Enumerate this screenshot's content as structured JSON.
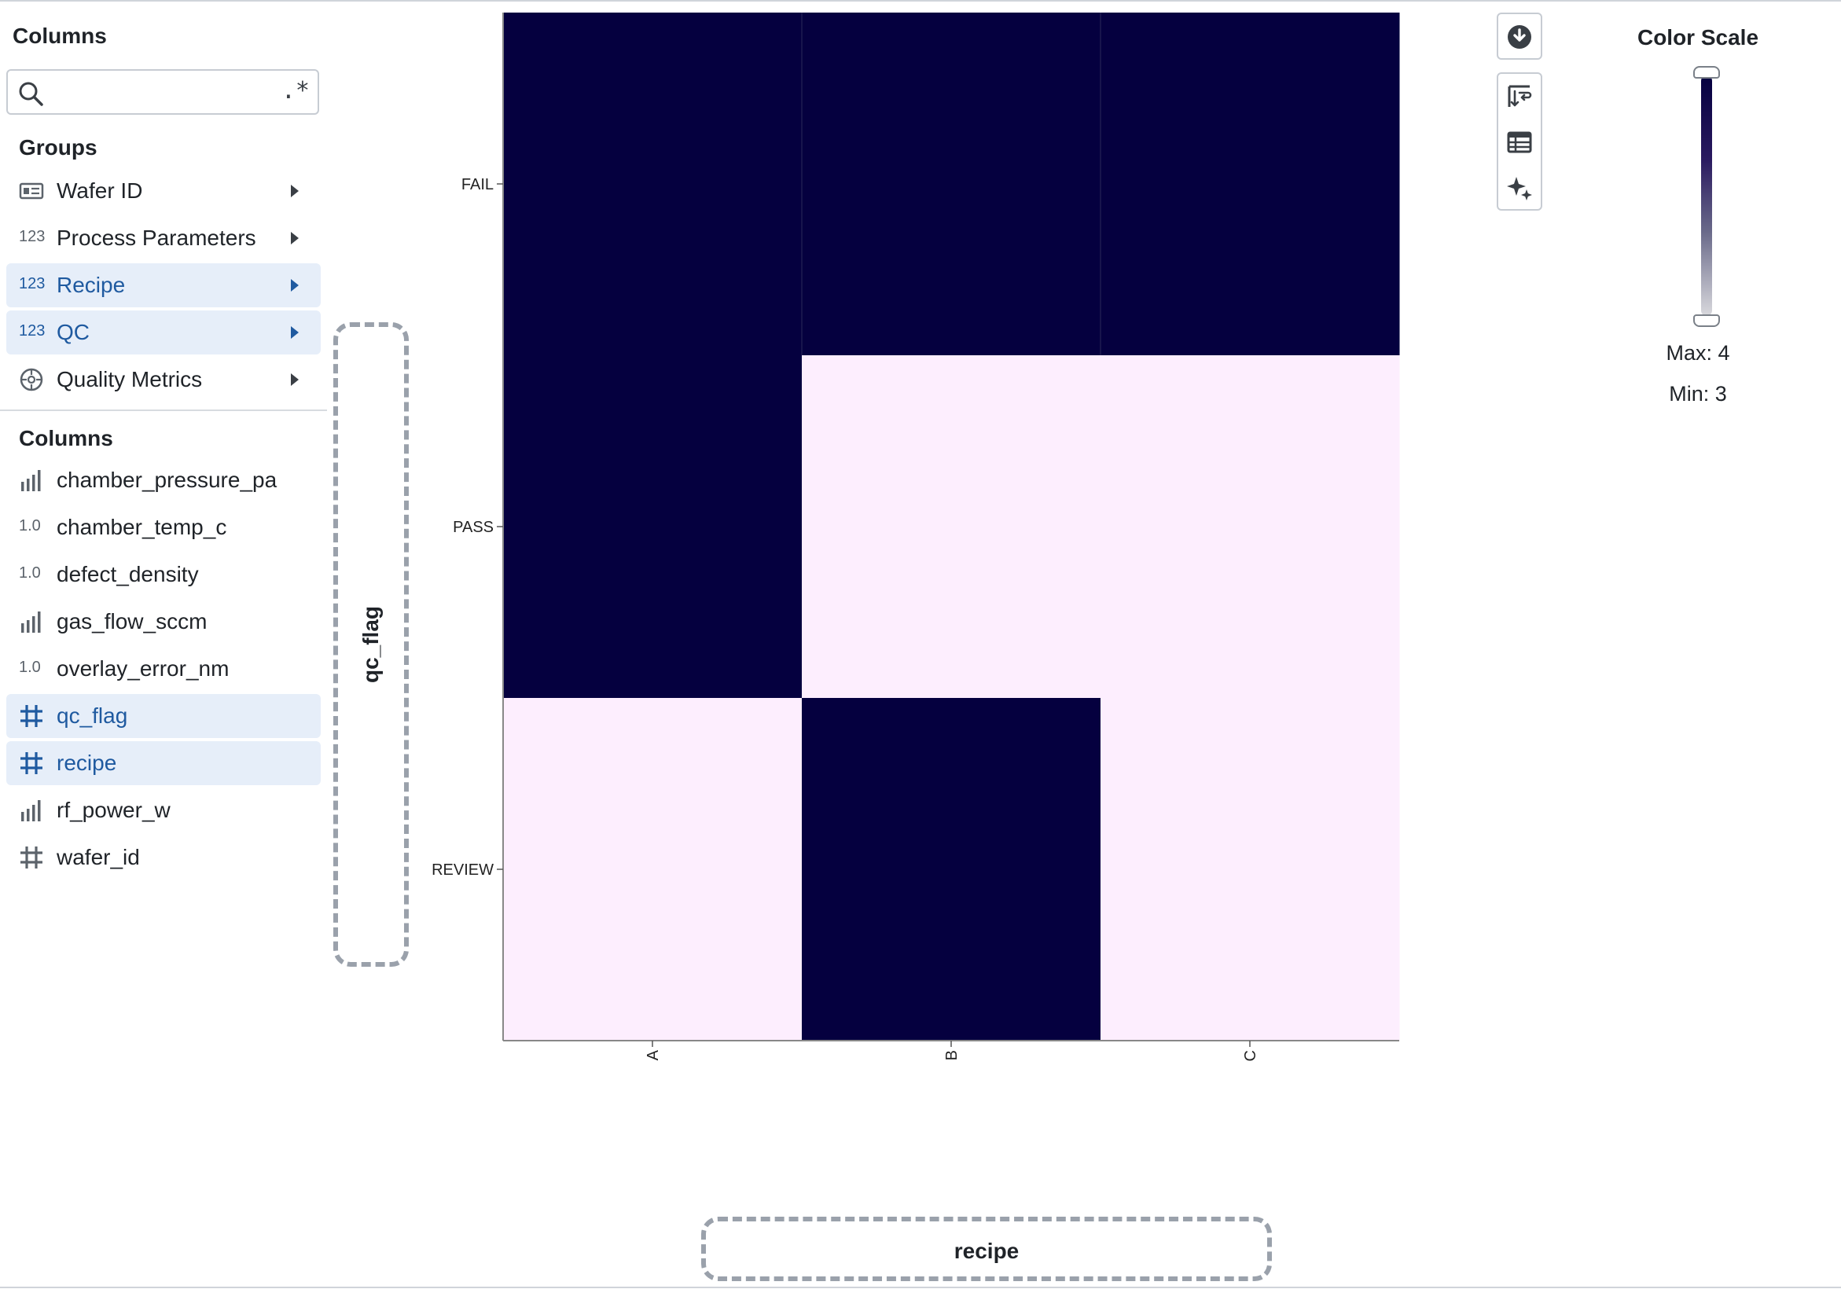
{
  "sidebar": {
    "title": "Columns",
    "search": {
      "placeholder": "",
      "regex_symbol": ".*"
    },
    "groups_label": "Groups",
    "groups": [
      {
        "icon": "id-card-icon",
        "label": "Wafer ID",
        "selected": false
      },
      {
        "icon": "123",
        "label": "Process Parameters",
        "selected": false
      },
      {
        "icon": "123",
        "label": "Recipe",
        "selected": true
      },
      {
        "icon": "123",
        "label": "QC",
        "selected": true
      },
      {
        "icon": "target-icon",
        "label": "Quality Metrics",
        "selected": false
      }
    ],
    "columns_label": "Columns",
    "columns": [
      {
        "icon": "bars-icon",
        "label": "chamber_pressure_pa",
        "selected": false
      },
      {
        "icon": "1.0",
        "label": "chamber_temp_c",
        "selected": false
      },
      {
        "icon": "1.0",
        "label": "defect_density",
        "selected": false
      },
      {
        "icon": "bars-icon",
        "label": "gas_flow_sccm",
        "selected": false
      },
      {
        "icon": "1.0",
        "label": "overlay_error_nm",
        "selected": false
      },
      {
        "icon": "grid-icon",
        "label": "qc_flag",
        "selected": true
      },
      {
        "icon": "grid-icon",
        "label": "recipe",
        "selected": true
      },
      {
        "icon": "bars-icon",
        "label": "rf_power_w",
        "selected": false
      },
      {
        "icon": "grid-icon",
        "label": "wafer_id",
        "selected": false
      }
    ]
  },
  "drop_zones": {
    "y": "qc_flag",
    "x": "recipe"
  },
  "toolbar": [
    "download-icon",
    "sort-icon",
    "table-icon",
    "sparkle-icon"
  ],
  "color_scale": {
    "title": "Color Scale",
    "max_label": "Max: 4",
    "min_label": "Min: 3",
    "low_color": "#fdeefe",
    "high_color": "#05003f"
  },
  "chart_data": {
    "type": "heatmap",
    "x_categories": [
      "A",
      "B",
      "C"
    ],
    "y_categories": [
      "FAIL",
      "PASS",
      "REVIEW"
    ],
    "values": [
      [
        4,
        4,
        4
      ],
      [
        4,
        3,
        3
      ],
      [
        3,
        4,
        3
      ]
    ],
    "min": 3,
    "max": 4
  }
}
